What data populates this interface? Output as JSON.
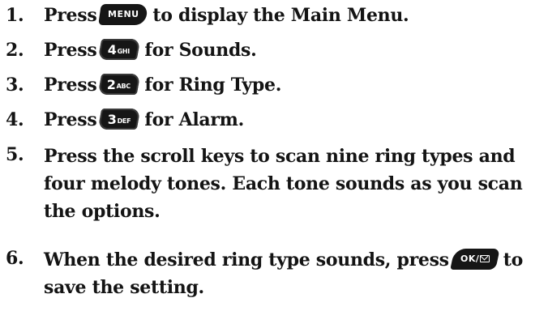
{
  "steps": [
    {
      "number": "1.",
      "before": "Press",
      "key": {
        "kind": "menu",
        "label": "MENU"
      },
      "after": "to display the Main Menu."
    },
    {
      "number": "2.",
      "before": "Press",
      "key": {
        "kind": "num",
        "digit": "4",
        "letters": "GHI"
      },
      "after": "for Sounds."
    },
    {
      "number": "3.",
      "before": "Press",
      "key": {
        "kind": "num",
        "digit": "2",
        "letters": "ABC"
      },
      "after": "for Ring Type."
    },
    {
      "number": "4.",
      "before": "Press",
      "key": {
        "kind": "num",
        "digit": "3",
        "letters": "DEF"
      },
      "after": "for Alarm."
    },
    {
      "number": "5.",
      "text": "Press the scroll keys to scan nine ring types and four melody tones. Each tone sounds as you scan the options."
    },
    {
      "number": "6.",
      "before": "When the desired ring type sounds, press",
      "key": {
        "kind": "ok",
        "label": "OK/"
      },
      "after": "to save the setting."
    }
  ],
  "colors": {
    "text": "#141414",
    "key_fill": "#161616",
    "key_text": "#ffffff"
  },
  "icons": {
    "menu_key": "menu-key-icon",
    "ok_key": "ok-message-key-icon",
    "message": "envelope-icon"
  }
}
